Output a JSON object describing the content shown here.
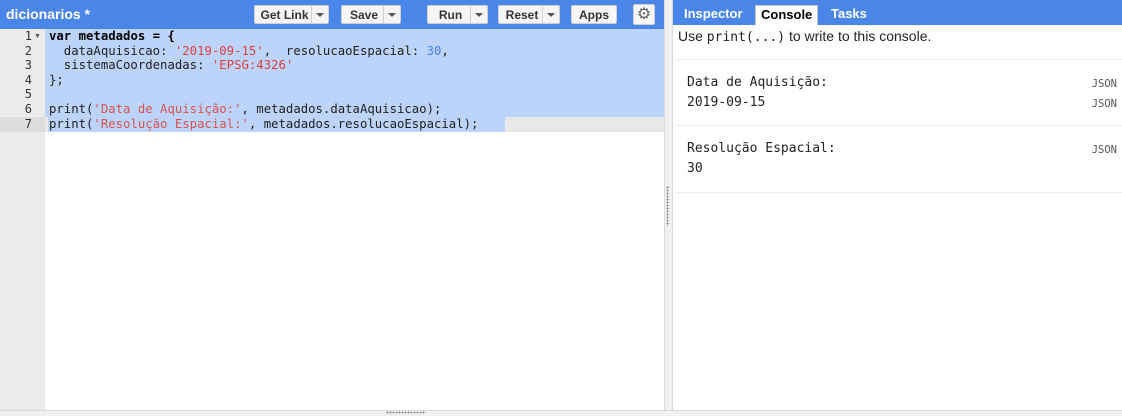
{
  "editor": {
    "file_title": "dicionarios *",
    "toolbar": {
      "get_link": "Get Link",
      "save": "Save",
      "run": "Run",
      "reset": "Reset",
      "apps": "Apps",
      "settings_icon": "gear-icon"
    },
    "line_numbers": [
      "1",
      "2",
      "3",
      "4",
      "5",
      "6",
      "7"
    ],
    "code": {
      "l1_kw": "var",
      "l1_rest": " metadados = {",
      "l2_a": "  dataAquisicao: ",
      "l2_str": "'2019-09-15'",
      "l2_b": ",  resolucaoEspacial: ",
      "l2_num": "30",
      "l2_c": ",",
      "l3_a": "  sistemaCoordenadas: ",
      "l3_str": "'EPSG:4326'",
      "l4": "};",
      "l6_a": "print(",
      "l6_str": "'Data de Aquisição:'",
      "l6_b": ", metadados.dataAquisicao);",
      "l7_a": "print(",
      "l7_str": "'Resolução Espacial:'",
      "l7_b": ", metadados.resolucaoEspacial);"
    }
  },
  "right_panel": {
    "tabs": [
      "Inspector",
      "Console",
      "Tasks"
    ],
    "active_tab": "Console",
    "console_hint_a": "Use ",
    "console_hint_code": "print(...)",
    "console_hint_b": " to write to this console.",
    "entries": [
      {
        "label": "Data de Aquisição:",
        "value": "2019-09-15",
        "json": "JSON"
      },
      {
        "label": "Resolução Espacial:",
        "value": "30",
        "json": "JSON"
      }
    ]
  },
  "colors": {
    "header_blue": "#4a86e8",
    "selection": "#bcd4f9",
    "string_red": "#c41a16",
    "number_blue": "#4a7ff0"
  }
}
